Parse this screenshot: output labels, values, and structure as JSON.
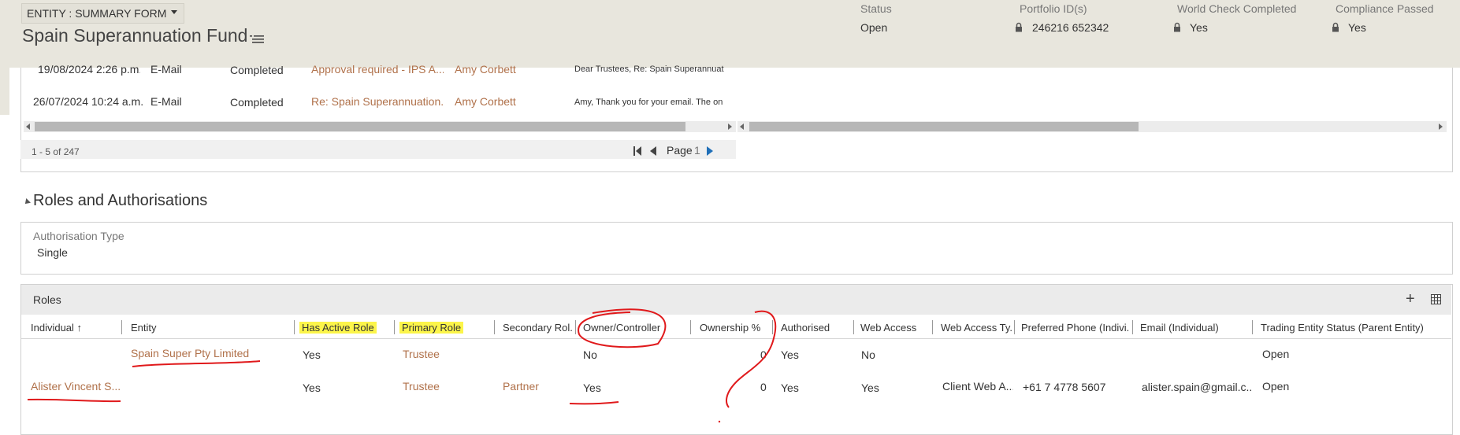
{
  "header": {
    "form_selector": "ENTITY : SUMMARY FORM",
    "record_title": "Spain Superannuation Fund",
    "fields": [
      {
        "label": "Status",
        "value": "Open"
      },
      {
        "label": "Portfolio ID(s)",
        "value": "246216 652342"
      },
      {
        "label": "World Check Completed",
        "value": "Yes"
      },
      {
        "label": "Compliance Passed",
        "value": "Yes"
      }
    ]
  },
  "activities": {
    "rows": [
      {
        "date": "19/08/2024 2:26 p.m.",
        "type": "E-Mail",
        "status": "Completed",
        "subject": "Approval required - IPS A...",
        "owner": "Amy Corbett",
        "description": "Dear Trustees,   Re:  Spain Superannuat"
      },
      {
        "date": "26/07/2024 10:24 a.m.",
        "type": "E-Mail",
        "status": "Completed",
        "subject": "Re: Spain Superannuation...",
        "owner": "Amy Corbett",
        "description": "Amy, Thank you for your email. The on"
      }
    ],
    "record_count": "1 - 5 of 247",
    "page_label": "Page",
    "page_number": "1"
  },
  "roles_section": {
    "title": "Roles and Authorisations",
    "authorisation_type_label": "Authorisation Type",
    "authorisation_type_value": "Single",
    "roles_title": "Roles",
    "columns": [
      "Individual ↑",
      "Entity",
      "Has Active Role",
      "Primary Role",
      "Secondary Rol...",
      "Owner/Controller",
      "Ownership %",
      "Authorised",
      "Web Access",
      "Web Access Ty...",
      "Preferred Phone (Indivi...",
      "Email (Individual)",
      "Trading Entity Status (Parent Entity)"
    ],
    "rows": [
      {
        "individual": "",
        "entity": "Spain Super Pty Limited",
        "has_active_role": "Yes",
        "primary_role": "Trustee",
        "secondary_role": "",
        "owner_controller": "No",
        "ownership_pct": "0",
        "authorised": "Yes",
        "web_access": "No",
        "web_access_type": "",
        "phone": "",
        "email": "",
        "trading_status": "Open"
      },
      {
        "individual": "Alister Vincent S...",
        "entity": "",
        "has_active_role": "Yes",
        "primary_role": "Trustee",
        "secondary_role": "Partner",
        "owner_controller": "Yes",
        "ownership_pct": "0",
        "authorised": "Yes",
        "web_access": "Yes",
        "web_access_type": "Client Web A...",
        "phone": "+61 7 4778 5607",
        "email": "alister.spain@gmail.c...",
        "trading_status": "Open"
      }
    ]
  },
  "colors": {
    "header_bg": "#e8e6dd",
    "link": "#b0714a",
    "highlight": "#fcf54a",
    "annotation": "#e0191b",
    "pager_blue": "#1f6fb8"
  },
  "icons": [
    "chevron-down-icon",
    "menu-lines-icon",
    "lock-icon",
    "scroll-left-icon",
    "scroll-right-icon",
    "first-page-icon",
    "prev-page-icon",
    "next-page-icon",
    "collapse-triangle-icon",
    "add-icon",
    "grid-view-icon",
    "sort-up-icon"
  ]
}
